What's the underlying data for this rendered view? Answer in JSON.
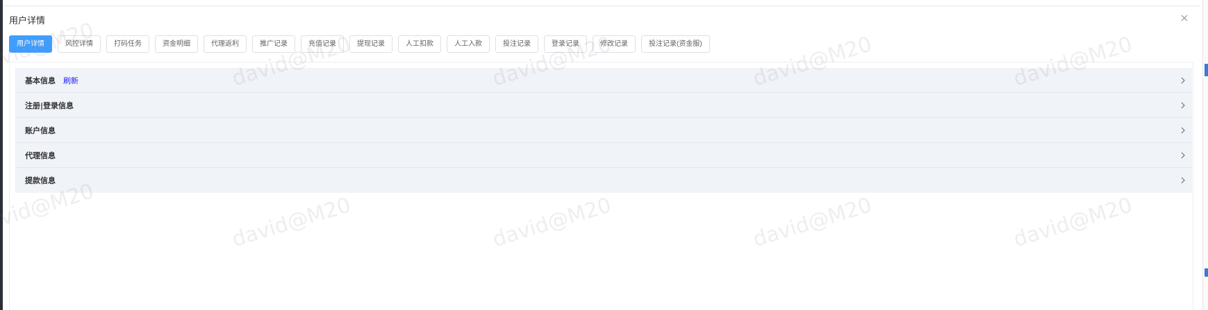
{
  "dialog": {
    "title": "用户详情",
    "close_icon": "close-icon"
  },
  "tabs": [
    {
      "label": "用户详情",
      "active": true
    },
    {
      "label": "风控详情",
      "active": false
    },
    {
      "label": "打码任务",
      "active": false
    },
    {
      "label": "资金明细",
      "active": false
    },
    {
      "label": "代理返利",
      "active": false
    },
    {
      "label": "推广记录",
      "active": false
    },
    {
      "label": "充值记录",
      "active": false
    },
    {
      "label": "提现记录",
      "active": false
    },
    {
      "label": "人工扣款",
      "active": false
    },
    {
      "label": "人工入款",
      "active": false
    },
    {
      "label": "投注记录",
      "active": false
    },
    {
      "label": "登录记录",
      "active": false
    },
    {
      "label": "修改记录",
      "active": false
    },
    {
      "label": "投注记录(资金服)",
      "active": false
    }
  ],
  "sections": [
    {
      "title": "基本信息",
      "link": "刷新"
    },
    {
      "title": "注册|登录信息"
    },
    {
      "title": "账户信息"
    },
    {
      "title": "代理信息"
    },
    {
      "title": "提款信息"
    }
  ],
  "watermark": {
    "text": "david@M20"
  },
  "colors": {
    "primary": "#409eff",
    "section_bg": "#f0f3f8",
    "link": "#1a1aff"
  }
}
